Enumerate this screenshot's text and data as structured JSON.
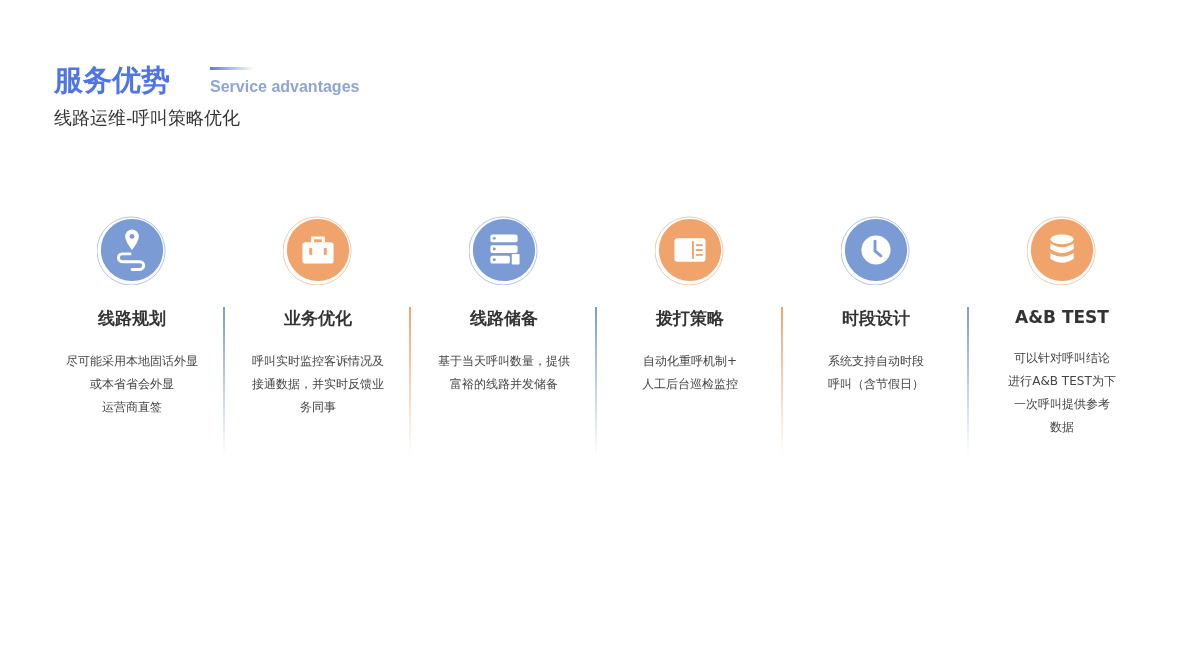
{
  "header": {
    "title": "服务优势",
    "subtitle_en": "Service advantages",
    "subtitle": "线路运维-呼叫策略优化"
  },
  "features": [
    {
      "kind": "route",
      "color": "#7b9bd4",
      "title": "线路规划",
      "lines": [
        "尽可能采用本地固话外显",
        "或本省省会外显",
        "运营商直签"
      ]
    },
    {
      "kind": "briefcase",
      "color": "#f0a46c",
      "title": "业务优化",
      "lines": [
        "呼叫实时监控客诉情况及",
        "接通数据，并实时反馈业",
        "务同事"
      ]
    },
    {
      "kind": "server",
      "color": "#7b9bd4",
      "title": "线路储备",
      "lines": [
        "基于当天呼叫数量，提供",
        "富裕的线路并发储备"
      ]
    },
    {
      "kind": "card",
      "color": "#f0a46c",
      "title": "拨打策略",
      "lines": [
        "自动化重呼机制+",
        "人工后台巡检监控"
      ]
    },
    {
      "kind": "clock",
      "color": "#7b9bd4",
      "title": "时段设计",
      "lines": [
        "系统支持自动时段",
        "呼叫（含节假日）"
      ]
    },
    {
      "kind": "database",
      "color": "#f0a46c",
      "title": "A&B TEST",
      "lines": [
        "可以针对呼叫结论",
        "进行A&B TEST为下",
        "一次呼叫提供参考",
        "数据"
      ]
    }
  ]
}
